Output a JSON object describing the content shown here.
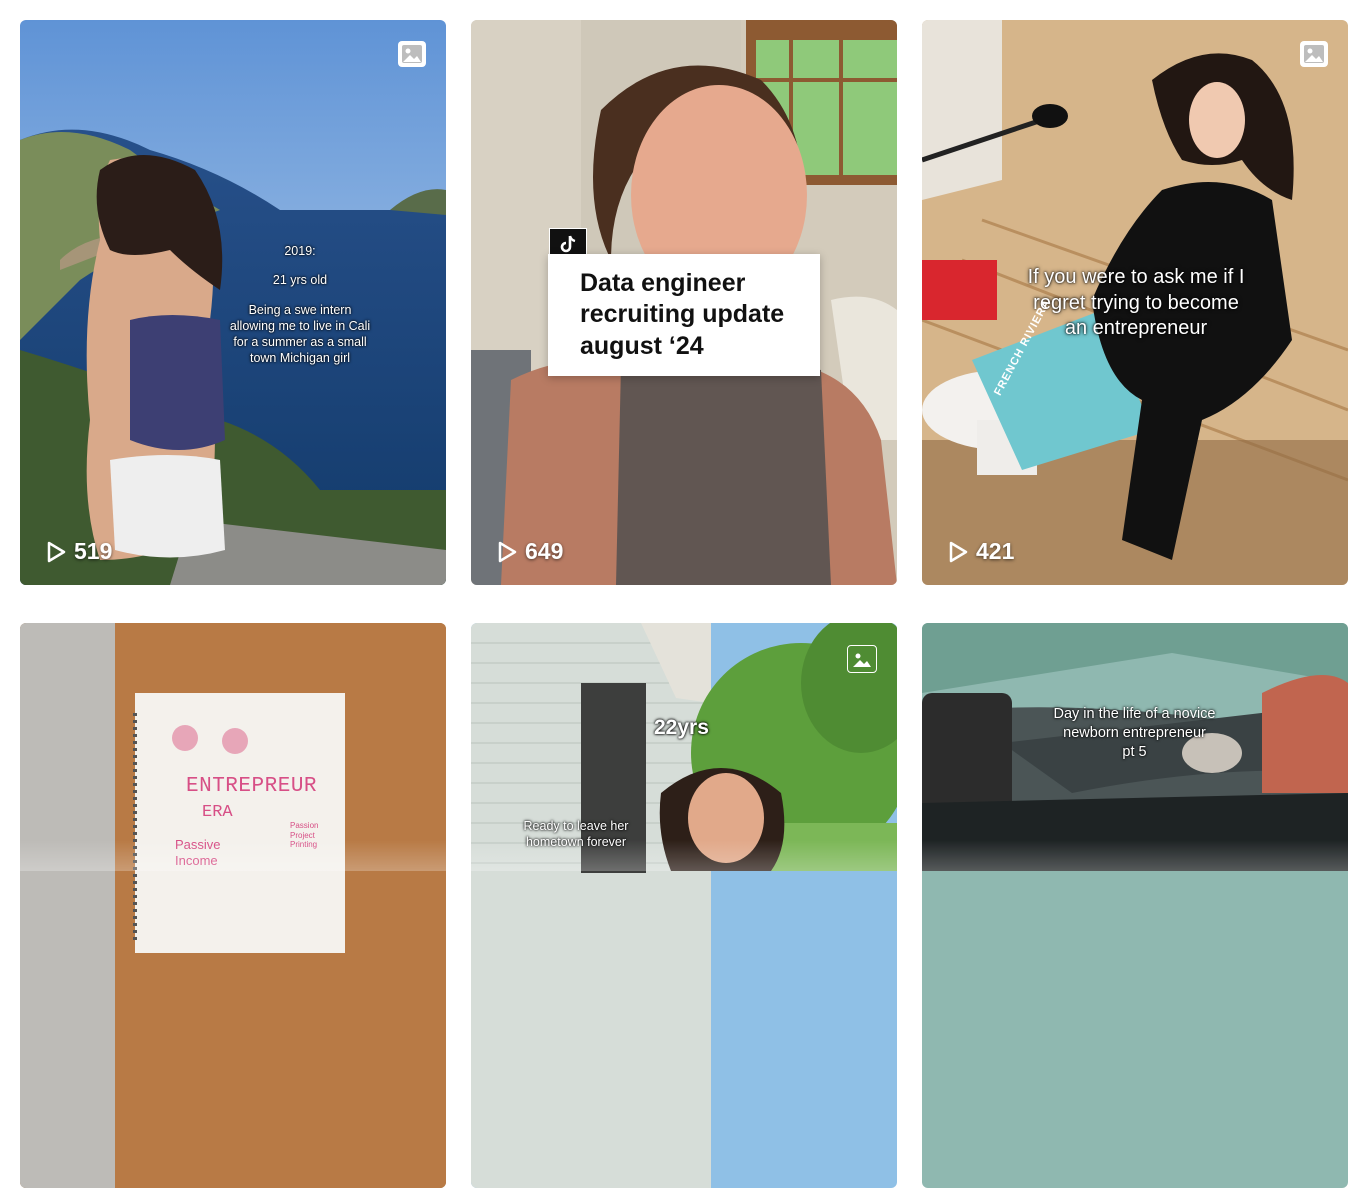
{
  "posts": [
    {
      "id_label": "post-1",
      "views": "519",
      "overlay": [
        "2019:",
        "21 yrs old",
        "Being a swe intern",
        "allowing me to live in Cali",
        "for a summer as a small",
        "town Michigan girl"
      ]
    },
    {
      "id_label": "post-2",
      "views": "649",
      "title_lines": [
        "Data engineer",
        "recruiting update",
        "august ‘24"
      ]
    },
    {
      "id_label": "post-3",
      "views": "421",
      "overlay": [
        "If you were to ask me if I",
        "regret trying to become",
        "an entrepreneur"
      ],
      "book_text": "FRENCH RIVIERA"
    },
    {
      "id_label": "post-4",
      "notebook": {
        "headline": "ENTREPREUR",
        "sub": "ERA",
        "left_note": "Passive Income",
        "right_note": "Passion Project Printing"
      }
    },
    {
      "id_label": "post-5",
      "age": "22yrs",
      "overlay": [
        "Ready to leave her",
        "hometown forever"
      ]
    },
    {
      "id_label": "post-6",
      "overlay": [
        "Day in the life of a novice",
        "newborn entrepreneur",
        "pt 5"
      ]
    }
  ],
  "icons": {
    "photo": "image-icon",
    "play": "play-icon",
    "tiktok": "tiktok-icon"
  },
  "colors": {
    "background": "#ffffff",
    "tiktok_badge": "#111111"
  }
}
